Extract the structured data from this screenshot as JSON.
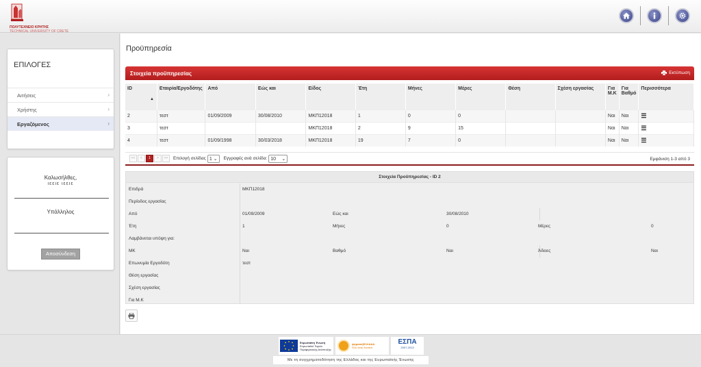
{
  "header": {
    "logo_line1": "ΠΟΛΥΤΕΧΝΕΙΟ ΚΡΗΤΗΣ",
    "logo_line2": "TECHNICAL UNIVERSITY OF CRETE",
    "buttons": [
      "home-icon",
      "info-icon",
      "settings-icon"
    ]
  },
  "sidebar": {
    "menu_title": "ΕΠΙΛΟΓΕΣ",
    "items": [
      {
        "label": "Αιτήσεις",
        "active": false
      },
      {
        "label": "Χρήστης",
        "active": false
      },
      {
        "label": "Εργαζόμενος",
        "active": true
      }
    ],
    "welcome": "Καλωσήλθες,",
    "username": "ιεειε ιεειε",
    "role": "Υπάλληλος",
    "logout": "Αποσύνδεση"
  },
  "main": {
    "page_title": "Προϋπηρεσία",
    "panel_title": "Στοιχεία προϋπηρεσίας",
    "print_label": "Εκτύπωση",
    "columns": [
      "ID",
      "Εταιρία/Εργοδότης",
      "Από",
      "Εώς και",
      "Είδος",
      "Έτη",
      "Μήνες",
      "Μέρες",
      "Θέση",
      "Σχέση εργασίας",
      "Για Μ.Κ",
      "Για Βαθμό",
      "Περισσότερα"
    ],
    "rows": [
      [
        "2",
        "τεστ",
        "01/09/2009",
        "30/08/2010",
        "ΜΚΠ12018",
        "1",
        "0",
        "0",
        "",
        "",
        "Ναι",
        "Ναι"
      ],
      [
        "3",
        "τεστ",
        "",
        "",
        "ΜΚΠ12018",
        "2",
        "9",
        "15",
        "",
        "",
        "Ναι",
        "Ναι"
      ],
      [
        "4",
        "τεστ",
        "01/09/1998",
        "30/03/2018",
        "ΜΚΠ12018",
        "19",
        "7",
        "0",
        "",
        "",
        "Ναι",
        "Ναι"
      ]
    ],
    "pager": {
      "buttons": [
        "<<",
        "<",
        "1",
        ">",
        ">>"
      ],
      "page_label": "Επιλογή σελίδας",
      "page_value": "1",
      "per_page_label": "Εγγραφές ανά σελίδα:",
      "per_page_value": "10",
      "showing": "Εμφάνιση 1-3 από 3"
    },
    "details": {
      "title": "Στοιχεία Προϋπηρεσίας - ID 2",
      "epidra_label": "Επιδρά",
      "epidra_value": "ΜΚΠ12018",
      "period_label": "Περίοδος εργασίας",
      "from_label": "Από",
      "from_value": "01/09/2009",
      "to_label": "Εώς και",
      "to_value": "30/08/2010",
      "years_label": "Έτη",
      "years_value": "1",
      "months_label": "Μήνες",
      "months_value": "0",
      "days_label": "Μέρες",
      "days_value": "0",
      "considered_label": "Λαμβάνεται υπόψη για:",
      "mk_label": "ΜΚ",
      "mk_value": "Ναι",
      "grade_label": "Βαθμό",
      "grade_value": "Ναι",
      "leave_label": "Άδειες",
      "leave_value": "Ναι",
      "employer_label": "Επωνυμία Εργοδότη",
      "employer_value": "τεστ",
      "position_label": "Θέση εργασίας",
      "relation_label": "Σχέση εργασίας",
      "formk_label": "Για Μ.Κ"
    }
  },
  "footer": {
    "eu_text": "Ευρωπαϊκή Ένωση",
    "eu_sub1": "Ευρωπαϊκό Ταμείο",
    "eu_sub2": "Περιφερειακής Ανάπτυξης",
    "digital_title": "ψηφιακήΕΛΛΑΔΑ",
    "digital_sub": "Όλο είναι δυνατά",
    "espa": "ΕΣΠΑ",
    "espa_years": "2007-2013",
    "caption": "Με τη συγχρηματοδότηση της Ελλάδας και της Ευρωπαϊκής Ένωσης"
  }
}
